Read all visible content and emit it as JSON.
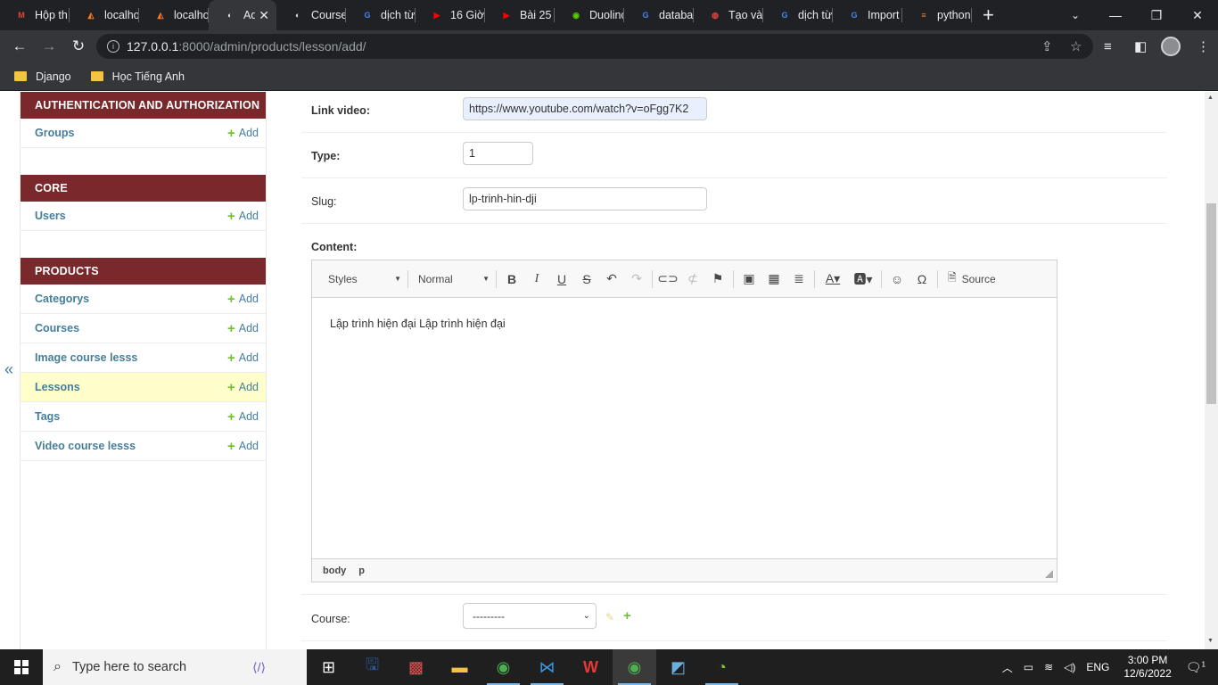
{
  "browser": {
    "tabs": [
      {
        "title": "Hộp th",
        "icon": "gmail-icon",
        "color": "#ea4335",
        "glyph": "M"
      },
      {
        "title": "localho",
        "icon": "xampp-icon",
        "color": "#fb7a24",
        "glyph": "◭"
      },
      {
        "title": "localho",
        "icon": "xampp-icon",
        "color": "#fb7a24",
        "glyph": "◭"
      },
      {
        "title": "Adı",
        "icon": "globe-icon",
        "color": "#e8eaed",
        "glyph": "◐",
        "active": true
      },
      {
        "title": "Course",
        "icon": "globe-icon",
        "color": "#e8eaed",
        "glyph": "◐"
      },
      {
        "title": "dịch từ",
        "icon": "google-icon",
        "color": "#4285f4",
        "glyph": "G"
      },
      {
        "title": "16 Giờ",
        "icon": "youtube-icon",
        "color": "#ff0000",
        "glyph": "▶"
      },
      {
        "title": "Bài 25",
        "icon": "youtube-icon",
        "color": "#ff0000",
        "glyph": "▶"
      },
      {
        "title": "Duolinc",
        "icon": "duolingo-icon",
        "color": "#58cc02",
        "glyph": "◉"
      },
      {
        "title": "databa",
        "icon": "google-icon",
        "color": "#4285f4",
        "glyph": "G"
      },
      {
        "title": "Tạo và",
        "icon": "slides-icon",
        "color": "#e8453c",
        "glyph": "◍"
      },
      {
        "title": "dịch từ",
        "icon": "google-icon",
        "color": "#4285f4",
        "glyph": "G"
      },
      {
        "title": "Import",
        "icon": "google-icon",
        "color": "#4285f4",
        "glyph": "G"
      },
      {
        "title": "python",
        "icon": "stackoverflow-icon",
        "color": "#f48024",
        "glyph": "≡"
      }
    ],
    "active_tab_close": "✕",
    "new_tab": "+",
    "url_host": "127.0.0.1",
    "url_path": ":8000/admin/products/lesson/add/",
    "bookmarks": [
      "Django",
      "Học Tiếng Anh"
    ]
  },
  "sidebar": {
    "toggle": "«",
    "modules": [
      {
        "caption": "AUTHENTICATION AND AUTHORIZATION",
        "rows": [
          {
            "name": "Groups",
            "add": "Add"
          }
        ]
      },
      {
        "caption": "CORE",
        "rows": [
          {
            "name": "Users",
            "add": "Add"
          }
        ]
      },
      {
        "caption": "PRODUCTS",
        "rows": [
          {
            "name": "Categorys",
            "add": "Add"
          },
          {
            "name": "Courses",
            "add": "Add"
          },
          {
            "name": "Image course lesss",
            "add": "Add"
          },
          {
            "name": "Lessons",
            "add": "Add",
            "selected": true
          },
          {
            "name": "Tags",
            "add": "Add"
          },
          {
            "name": "Video course lesss",
            "add": "Add"
          }
        ]
      }
    ]
  },
  "form": {
    "link_video": {
      "label": "Link video:",
      "value": "https://www.youtube.com/watch?v=oFgg7K2"
    },
    "type": {
      "label": "Type:",
      "value": "1"
    },
    "slug": {
      "label": "Slug:",
      "value": "lp-trinh-hin-dji"
    },
    "content": {
      "label": "Content:",
      "styles_combo": "Styles",
      "format_combo": "Normal",
      "source_label": "Source",
      "body_text": "Lập trình hiện đại Lập trình hiện đại",
      "path": [
        "body",
        "p"
      ]
    },
    "course": {
      "label": "Course:",
      "value": "---------"
    }
  },
  "taskbar": {
    "search_placeholder": "Type here to search",
    "lang": "ENG",
    "time": "3:00 PM",
    "date": "12/6/2022",
    "notifications": "1"
  },
  "colors": {
    "admin_header": "#79292b",
    "link": "#447e9b",
    "add_green": "#70bf2b",
    "selected_row": "#ffffcc"
  }
}
